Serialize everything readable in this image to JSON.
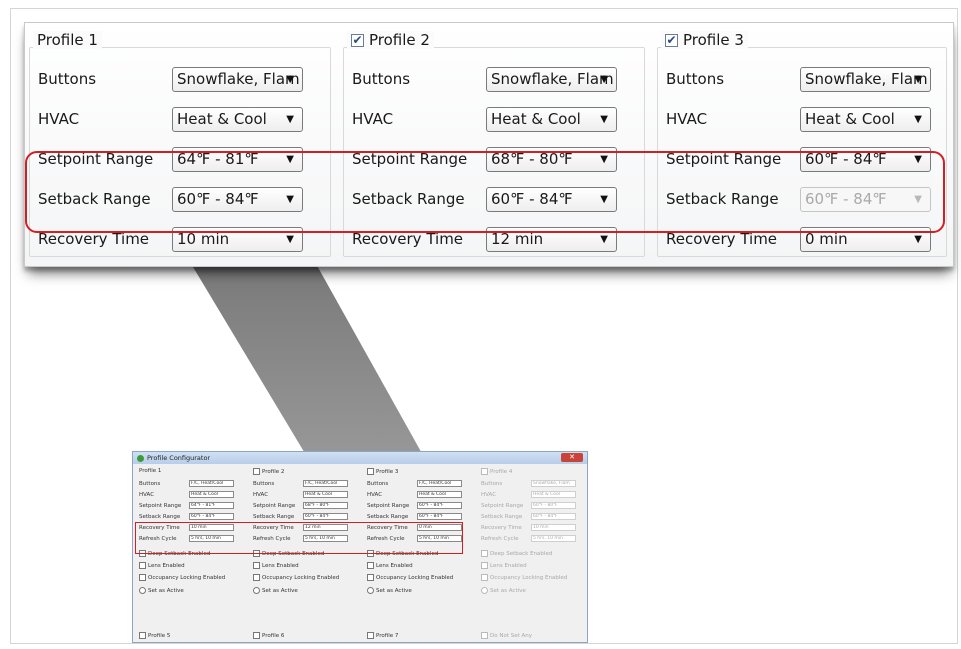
{
  "zoom": {
    "profiles": [
      {
        "title": "Profile 1",
        "checkbox": false,
        "checked": false,
        "rows": [
          {
            "label": "Buttons",
            "value": "Snowflake, Flam",
            "disabled": false
          },
          {
            "label": "HVAC",
            "value": "Heat & Cool",
            "disabled": false
          },
          {
            "label": "Setpoint Range",
            "value": "64℉ - 81℉",
            "disabled": false
          },
          {
            "label": "Setback Range",
            "value": "60℉ - 84℉",
            "disabled": false
          },
          {
            "label": "Recovery Time",
            "value": "10 min",
            "disabled": false
          }
        ]
      },
      {
        "title": "Profile 2",
        "checkbox": true,
        "checked": true,
        "rows": [
          {
            "label": "Buttons",
            "value": "Snowflake, Flam",
            "disabled": false
          },
          {
            "label": "HVAC",
            "value": "Heat & Cool",
            "disabled": false
          },
          {
            "label": "Setpoint Range",
            "value": "68℉ - 80℉",
            "disabled": false
          },
          {
            "label": "Setback Range",
            "value": "60℉ - 84℉",
            "disabled": false
          },
          {
            "label": "Recovery Time",
            "value": "12 min",
            "disabled": false
          }
        ]
      },
      {
        "title": "Profile 3",
        "checkbox": true,
        "checked": true,
        "rows": [
          {
            "label": "Buttons",
            "value": "Snowflake, Flam",
            "disabled": false
          },
          {
            "label": "HVAC",
            "value": "Heat & Cool",
            "disabled": false
          },
          {
            "label": "Setpoint Range",
            "value": "60℉ - 84℉",
            "disabled": false
          },
          {
            "label": "Setback Range",
            "value": "60℉ - 84℉",
            "disabled": true
          },
          {
            "label": "Recovery Time",
            "value": "0 min",
            "disabled": false
          }
        ]
      }
    ]
  },
  "mini": {
    "window_title": "Profile Configurator",
    "close_glyph": "✕",
    "columns": [
      {
        "title": "Profile 1",
        "has_checkbox": false,
        "faded": false,
        "rows": [
          {
            "label": "Buttons",
            "value": "F/C, Heat/Cool"
          },
          {
            "label": "HVAC",
            "value": "Heat & Cool"
          },
          {
            "label": "Setpoint Range",
            "value": "64℉ - 81℉"
          },
          {
            "label": "Setback Range",
            "value": "60℉ - 84℉"
          },
          {
            "label": "Recovery Time",
            "value": "10 min"
          },
          {
            "label": "Refresh Cycle",
            "value": "5 hrs, 10 min"
          }
        ],
        "checks": [
          "Deep Setback Enabled",
          "Lens Enabled",
          "Occupancy Locking Enabled"
        ],
        "radio": "Set as Active",
        "footer": "Profile 5"
      },
      {
        "title": "Profile 2",
        "has_checkbox": true,
        "faded": false,
        "rows": [
          {
            "label": "Buttons",
            "value": "F/C, Heat/Cool"
          },
          {
            "label": "HVAC",
            "value": "Heat & Cool"
          },
          {
            "label": "Setpoint Range",
            "value": "68℉ - 80℉"
          },
          {
            "label": "Setback Range",
            "value": "60℉ - 84℉"
          },
          {
            "label": "Recovery Time",
            "value": "12 min"
          },
          {
            "label": "Refresh Cycle",
            "value": "5 hrs, 10 min"
          }
        ],
        "checks": [
          "Deep Setback Enabled",
          "Lens Enabled",
          "Occupancy Locking Enabled"
        ],
        "radio": "Set as Active",
        "footer": "Profile 6"
      },
      {
        "title": "Profile 3",
        "has_checkbox": true,
        "faded": false,
        "rows": [
          {
            "label": "Buttons",
            "value": "F/C, Heat/Cool"
          },
          {
            "label": "HVAC",
            "value": "Heat & Cool"
          },
          {
            "label": "Setpoint Range",
            "value": "60℉ - 84℉"
          },
          {
            "label": "Setback Range",
            "value": "60℉ - 84℉"
          },
          {
            "label": "Recovery Time",
            "value": "0 min"
          },
          {
            "label": "Refresh Cycle",
            "value": "5 hrs, 10 min"
          }
        ],
        "checks": [
          "Deep Setback Enabled",
          "Lens Enabled",
          "Occupancy Locking Enabled"
        ],
        "radio": "Set as Active",
        "footer": "Profile 7"
      },
      {
        "title": "Profile 4",
        "has_checkbox": true,
        "faded": true,
        "rows": [
          {
            "label": "Buttons",
            "value": "Snowflake, Flam"
          },
          {
            "label": "HVAC",
            "value": "Heat & Cool"
          },
          {
            "label": "Setpoint Range",
            "value": "60℉ - 80℉"
          },
          {
            "label": "Setback Range",
            "value": "60℉ - 84℉"
          },
          {
            "label": "Recovery Time",
            "value": "10 min"
          },
          {
            "label": "Refresh Cycle",
            "value": "5 hrs, 10 min"
          }
        ],
        "checks": [
          "Deep Setback Enabled",
          "Lens Enabled",
          "Occupancy Locking Enabled"
        ],
        "radio": "Set as Active",
        "footer": "Do Not Set Any"
      }
    ]
  },
  "colors": {
    "highlight": "#d11f25",
    "wedge": "#7a7a7a"
  }
}
